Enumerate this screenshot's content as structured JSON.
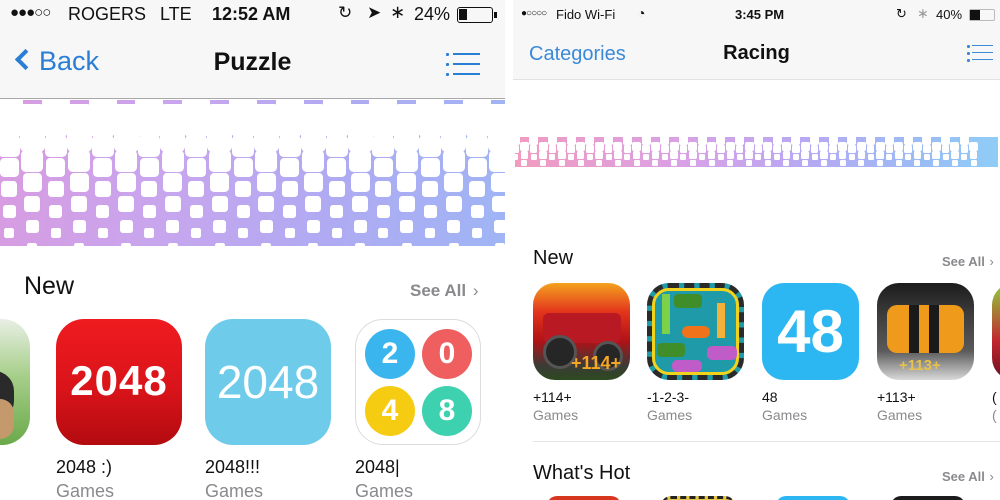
{
  "left": {
    "status": {
      "signal": "●●●○○",
      "carrier": "ROGERS",
      "network": "LTE",
      "time": "12:52 AM",
      "icons": [
        "orientation-lock-icon",
        "location-arrow-icon",
        "bluetooth-icon"
      ],
      "battery_percent_label": "24%",
      "battery_level": 0.24
    },
    "nav": {
      "back_label": "Back",
      "title": "Puzzle",
      "menu_icon": "list-icon"
    },
    "section": {
      "title": "New",
      "see_all": "See All",
      "apps": [
        {
          "name": "",
          "category": "",
          "icon_text": ""
        },
        {
          "name": "2048 :)",
          "category": "Games",
          "icon_text": "2048"
        },
        {
          "name": "2048!!!",
          "category": "Games",
          "icon_text": "2048"
        },
        {
          "name": "2048|",
          "category": "Games",
          "icon_digits": [
            "2",
            "0",
            "4",
            "8"
          ]
        }
      ]
    },
    "colors": {
      "accent": "#2a7fd4",
      "red_icon": "#d9141a",
      "blue_icon": "#6fcbea"
    }
  },
  "right": {
    "status": {
      "signal": "●○○○○",
      "carrier": "Fido Wi-Fi",
      "time": "3:45 PM",
      "icons": [
        "wifi-icon",
        "orientation-lock-icon",
        "bluetooth-icon"
      ],
      "battery_percent_label": "40%",
      "battery_level": 0.4
    },
    "nav": {
      "back_label": "Categories",
      "title": "Racing",
      "menu_icon": "list-icon"
    },
    "sections": [
      {
        "title": "New",
        "see_all": "See All",
        "apps": [
          {
            "name": "+114+",
            "category": "Games"
          },
          {
            "name": "-1-2-3-",
            "category": "Games"
          },
          {
            "name": "48",
            "category": "Games",
            "icon_text": "48"
          },
          {
            "name": "+113+",
            "category": "Games"
          },
          {
            "name": "(",
            "category": "("
          }
        ]
      },
      {
        "title": "What's Hot",
        "see_all": "See All"
      }
    ],
    "colors": {
      "accent": "#3a8ad6",
      "blue_48_icon": "#2cb7f2"
    }
  }
}
